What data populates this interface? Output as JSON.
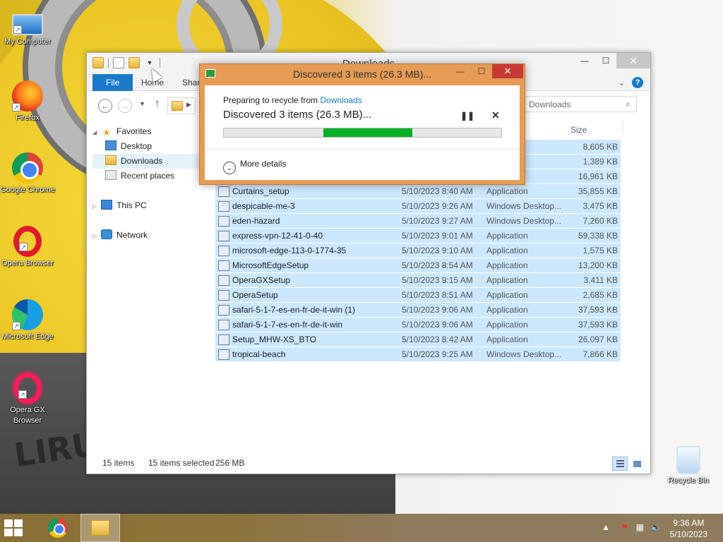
{
  "desktop": {
    "icons": [
      {
        "label": "My Computer"
      },
      {
        "label": "Firefox"
      },
      {
        "label": "Google Chrome"
      },
      {
        "label": "Opera Browser"
      },
      {
        "label": "Microsoft Edge"
      },
      {
        "label": "Opera GX Browser"
      },
      {
        "label": "Recycle Bin"
      }
    ],
    "wallpaper_text": "LIRU"
  },
  "explorer": {
    "title": "Downloads",
    "ribbon_tabs": [
      "File",
      "Home",
      "Shar"
    ],
    "search_placeholder": "Downloads",
    "column_size": "Size",
    "nav": {
      "favorites": "Favorites",
      "desktop": "Desktop",
      "downloads": "Downloads",
      "recent": "Recent places",
      "this_pc": "This PC",
      "network": "Network"
    },
    "partial_rows": [
      {
        "type": "ption",
        "size": "8,605 KB"
      },
      {
        "type": "ption",
        "size": "1,389 KB"
      },
      {
        "type": "ption",
        "size": "16,961 KB"
      }
    ],
    "files": [
      {
        "name": "Curtains_setup",
        "date": "5/10/2023 8:40 AM",
        "type": "Application",
        "size": "35,855 KB"
      },
      {
        "name": "despicable-me-3",
        "date": "5/10/2023 9:26 AM",
        "type": "Windows Desktop...",
        "size": "3,475 KB"
      },
      {
        "name": "eden-hazard",
        "date": "5/10/2023 9:27 AM",
        "type": "Windows Desktop...",
        "size": "7,260 KB"
      },
      {
        "name": "express-vpn-12-41-0-40",
        "date": "5/10/2023 9:01 AM",
        "type": "Application",
        "size": "59,338 KB"
      },
      {
        "name": "microsoft-edge-113-0-1774-35",
        "date": "5/10/2023 9:10 AM",
        "type": "Application",
        "size": "1,575 KB"
      },
      {
        "name": "MicrosoftEdgeSetup",
        "date": "5/10/2023 8:54 AM",
        "type": "Application",
        "size": "13,200 KB"
      },
      {
        "name": "OperaGXSetup",
        "date": "5/10/2023 9:15 AM",
        "type": "Application",
        "size": "3,411 KB"
      },
      {
        "name": "OperaSetup",
        "date": "5/10/2023 8:51 AM",
        "type": "Application",
        "size": "2,685 KB"
      },
      {
        "name": "safari-5-1-7-es-en-fr-de-it-win (1)",
        "date": "5/10/2023 9:06 AM",
        "type": "Application",
        "size": "37,593 KB"
      },
      {
        "name": "safari-5-1-7-es-en-fr-de-it-win",
        "date": "5/10/2023 9:06 AM",
        "type": "Application",
        "size": "37,593 KB"
      },
      {
        "name": "Setup_MHW-XS_BTO",
        "date": "5/10/2023 8:42 AM",
        "type": "Application",
        "size": "26,097 KB"
      },
      {
        "name": "tropical-beach",
        "date": "5/10/2023 9:25 AM",
        "type": "Windows Desktop...",
        "size": "7,866 KB"
      }
    ],
    "status": {
      "count": "15 items",
      "selected": "15 items selected",
      "size": "256 MB"
    }
  },
  "dialog": {
    "title": "Discovered 3 items (26.3 MB)...",
    "prep_prefix": "Preparing to recycle from ",
    "prep_link": "Downloads",
    "headline": "Discovered 3 items (26.3 MB)...",
    "progress": {
      "start": 0.36,
      "end": 0.68
    },
    "more_details": "More details",
    "progress_color": "#06b025"
  },
  "taskbar": {
    "time": "9:36 AM",
    "date": "5/10/2023"
  },
  "colors": {
    "accent": "#1979ca",
    "selection": "#cce8ff",
    "dialog_frame": "#e59c55"
  }
}
